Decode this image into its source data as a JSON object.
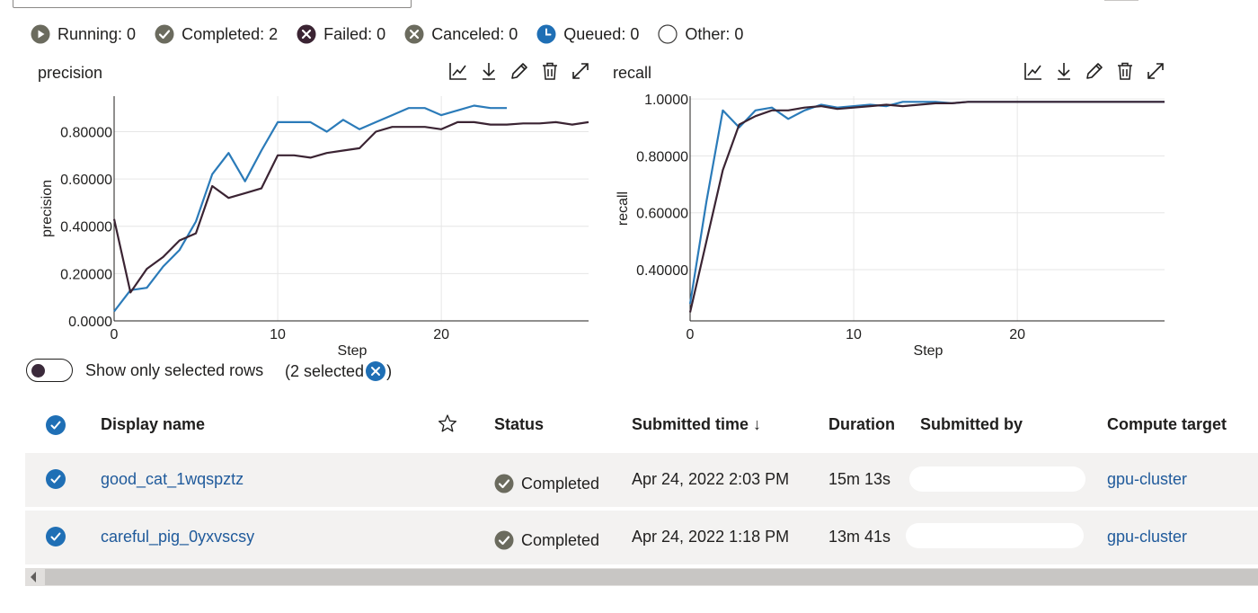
{
  "status_filters": [
    {
      "label": "Running: 0",
      "icon": "play-circle-icon"
    },
    {
      "label": "Completed: 2",
      "icon": "check-circle-icon"
    },
    {
      "label": "Failed: 0",
      "icon": "x-circle-dark-icon"
    },
    {
      "label": "Canceled: 0",
      "icon": "x-circle-gray-icon"
    },
    {
      "label": "Queued: 0",
      "icon": "clock-circle-icon"
    },
    {
      "label": "Other: 0",
      "icon": "empty-circle-icon"
    }
  ],
  "colors": {
    "series_blue": "#2b7bb9",
    "series_dark": "#3b2433",
    "accent": "#1f6fb5",
    "completed_gray": "#6b6b5e"
  },
  "charts": {
    "precision": {
      "title": "precision",
      "tools": [
        "line-chart-icon",
        "download-icon",
        "edit-icon",
        "delete-icon",
        "expand-icon"
      ],
      "chart_data": {
        "type": "line",
        "xlabel": "Step",
        "ylabel": "precision",
        "xlim": [
          0,
          29
        ],
        "ylim": [
          0,
          0.95
        ],
        "x_ticks": [
          0,
          10,
          20
        ],
        "y_ticks": [
          {
            "value": 0.0,
            "label": "0.0000"
          },
          {
            "value": 0.2,
            "label": "0.20000"
          },
          {
            "value": 0.4,
            "label": "0.40000"
          },
          {
            "value": 0.6,
            "label": "0.60000"
          },
          {
            "value": 0.8,
            "label": "0.80000"
          }
        ],
        "grid": true,
        "series": [
          {
            "x": [
              0,
              1,
              2,
              3,
              4,
              5,
              6,
              7,
              8,
              9,
              10,
              11,
              12,
              13,
              14,
              15,
              16,
              17,
              18,
              19,
              20,
              21,
              22,
              23,
              24
            ],
            "values": [
              0.04,
              0.13,
              0.14,
              0.23,
              0.3,
              0.42,
              0.62,
              0.71,
              0.59,
              0.72,
              0.84,
              0.84,
              0.84,
              0.8,
              0.85,
              0.81,
              0.84,
              0.87,
              0.9,
              0.9,
              0.87,
              0.89,
              0.91,
              0.9,
              0.9
            ]
          },
          {
            "x": [
              0,
              1,
              2,
              3,
              4,
              5,
              6,
              7,
              8,
              9,
              10,
              11,
              12,
              13,
              14,
              15,
              16,
              17,
              18,
              19,
              20,
              21,
              22,
              23,
              24,
              25,
              26,
              27,
              28,
              29
            ],
            "values": [
              0.43,
              0.12,
              0.22,
              0.27,
              0.34,
              0.37,
              0.57,
              0.52,
              0.54,
              0.56,
              0.7,
              0.7,
              0.69,
              0.71,
              0.72,
              0.73,
              0.8,
              0.82,
              0.82,
              0.82,
              0.81,
              0.84,
              0.84,
              0.83,
              0.83,
              0.835,
              0.835,
              0.84,
              0.83,
              0.84
            ]
          }
        ]
      }
    },
    "recall": {
      "title": "recall",
      "tools": [
        "line-chart-icon",
        "download-icon",
        "edit-icon",
        "delete-icon",
        "expand-icon"
      ],
      "chart_data": {
        "type": "line",
        "xlabel": "Step",
        "ylabel": "recall",
        "xlim": [
          0,
          29
        ],
        "ylim": [
          0.22,
          1.01
        ],
        "x_ticks": [
          0,
          10,
          20
        ],
        "y_ticks": [
          {
            "value": 0.4,
            "label": "0.40000"
          },
          {
            "value": 0.6,
            "label": "0.60000"
          },
          {
            "value": 0.8,
            "label": "0.80000"
          },
          {
            "value": 1.0,
            "label": "1.0000"
          }
        ],
        "grid": true,
        "series": [
          {
            "x": [
              0,
              1,
              2,
              3,
              4,
              5,
              6,
              7,
              8,
              9,
              10,
              11,
              12,
              13,
              14,
              15,
              16,
              17,
              18,
              19,
              20,
              21,
              22,
              23,
              24,
              25,
              26,
              27,
              28,
              29
            ],
            "values": [
              0.28,
              0.64,
              0.96,
              0.9,
              0.96,
              0.97,
              0.93,
              0.96,
              0.98,
              0.97,
              0.975,
              0.98,
              0.975,
              0.99,
              0.99,
              0.99,
              0.985,
              0.99,
              0.99,
              0.99,
              0.99,
              0.99,
              0.99,
              0.99,
              0.99,
              0.99,
              0.99,
              0.99,
              0.99,
              0.99
            ]
          },
          {
            "x": [
              0,
              1,
              2,
              3,
              4,
              5,
              6,
              7,
              8,
              9,
              10,
              11,
              12,
              13,
              14,
              15,
              16,
              17,
              18,
              19,
              20,
              21,
              22,
              23,
              24,
              25,
              26,
              27,
              28,
              29
            ],
            "values": [
              0.25,
              0.5,
              0.75,
              0.91,
              0.94,
              0.96,
              0.96,
              0.97,
              0.975,
              0.965,
              0.97,
              0.975,
              0.98,
              0.975,
              0.98,
              0.985,
              0.985,
              0.99,
              0.99,
              0.99,
              0.99,
              0.99,
              0.99,
              0.99,
              0.99,
              0.99,
              0.99,
              0.99,
              0.99,
              0.99
            ]
          }
        ]
      }
    }
  },
  "toggle": {
    "label": "Show only selected rows",
    "selected_prefix": "(2 selected",
    "selected_suffix": ")"
  },
  "table": {
    "headers": {
      "display_name": "Display name",
      "status": "Status",
      "submitted_time": "Submitted time ↓",
      "duration": "Duration",
      "submitted_by": "Submitted by",
      "compute_target": "Compute target"
    },
    "rows": [
      {
        "display_name": "good_cat_1wqspztz",
        "status": "Completed",
        "submitted_time": "Apr 24, 2022 2:03 PM",
        "duration": "15m 13s",
        "compute_target": "gpu-cluster"
      },
      {
        "display_name": "careful_pig_0yxvscsy",
        "status": "Completed",
        "submitted_time": "Apr 24, 2022 1:18 PM",
        "duration": "13m 41s",
        "compute_target": "gpu-cluster"
      }
    ]
  }
}
